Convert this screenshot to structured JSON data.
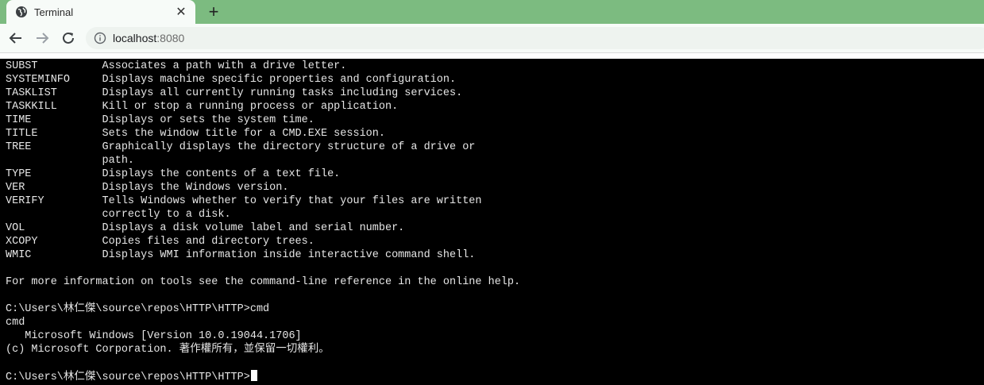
{
  "tab": {
    "title": "Terminal",
    "favicon": "globe-icon",
    "close_icon": "close-icon"
  },
  "toolbar": {
    "back_icon": "arrow-left-icon",
    "forward_icon": "arrow-right-icon",
    "reload_icon": "reload-icon",
    "address": {
      "host": "localhost",
      "port": ":8080",
      "info_icon": "info-icon"
    }
  },
  "terminal": {
    "lines": [
      "SUBST          Associates a path with a drive letter.",
      "SYSTEMINFO     Displays machine specific properties and configuration.",
      "TASKLIST       Displays all currently running tasks including services.",
      "TASKKILL       Kill or stop a running process or application.",
      "TIME           Displays or sets the system time.",
      "TITLE          Sets the window title for a CMD.EXE session.",
      "TREE           Graphically displays the directory structure of a drive or",
      "               path.",
      "TYPE           Displays the contents of a text file.",
      "VER            Displays the Windows version.",
      "VERIFY         Tells Windows whether to verify that your files are written",
      "               correctly to a disk.",
      "VOL            Displays a disk volume label and serial number.",
      "XCOPY          Copies files and directory trees.",
      "WMIC           Displays WMI information inside interactive command shell.",
      "",
      "For more information on tools see the command-line reference in the online help.",
      "",
      "C:\\Users\\林仁傑\\source\\repos\\HTTP\\HTTP>cmd",
      "cmd",
      "   Microsoft Windows [Version 10.0.19044.1706]",
      "(c) Microsoft Corporation. 著作權所有，並保留一切權利。",
      ""
    ],
    "prompt": "C:\\Users\\林仁傑\\source\\repos\\HTTP\\HTTP>"
  },
  "colors": {
    "tab_strip": "#7cbb80",
    "terminal_bg": "#000000",
    "terminal_fg": "#e6e6e6"
  }
}
